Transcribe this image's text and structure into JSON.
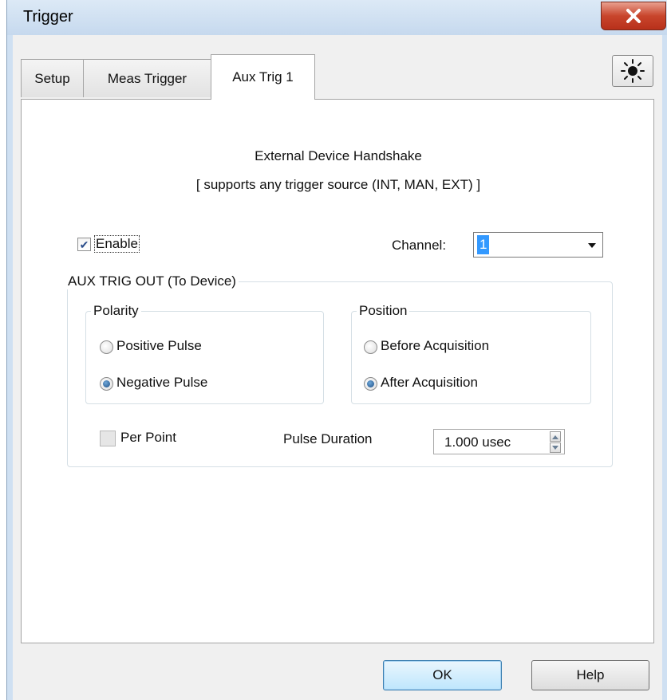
{
  "window": {
    "title": "Trigger"
  },
  "tabs": [
    {
      "label": "Setup",
      "active": false
    },
    {
      "label": "Meas Trigger",
      "active": false
    },
    {
      "label": "Aux Trig 1",
      "active": true
    }
  ],
  "heading": "External Device Handshake",
  "subheading": "[ supports any trigger source (INT, MAN, EXT) ]",
  "enable": {
    "label": "Enable",
    "checked": true
  },
  "channel": {
    "label": "Channel:",
    "value": "1"
  },
  "aux_trig_out": {
    "legend": "AUX TRIG OUT (To Device)",
    "polarity": {
      "legend": "Polarity",
      "options": [
        {
          "label": "Positive Pulse",
          "checked": false
        },
        {
          "label": "Negative Pulse",
          "checked": true
        }
      ]
    },
    "position": {
      "legend": "Position",
      "options": [
        {
          "label": "Before Acquisition",
          "checked": false
        },
        {
          "label": "After Acquisition",
          "checked": true
        }
      ]
    },
    "per_point": {
      "label": "Per Point",
      "checked": false
    },
    "pulse_duration": {
      "label": "Pulse Duration",
      "value": "1.000 usec"
    }
  },
  "buttons": {
    "ok": "OK",
    "help": "Help"
  },
  "icons": {
    "close": "close-icon",
    "sun": "sun-icon"
  }
}
